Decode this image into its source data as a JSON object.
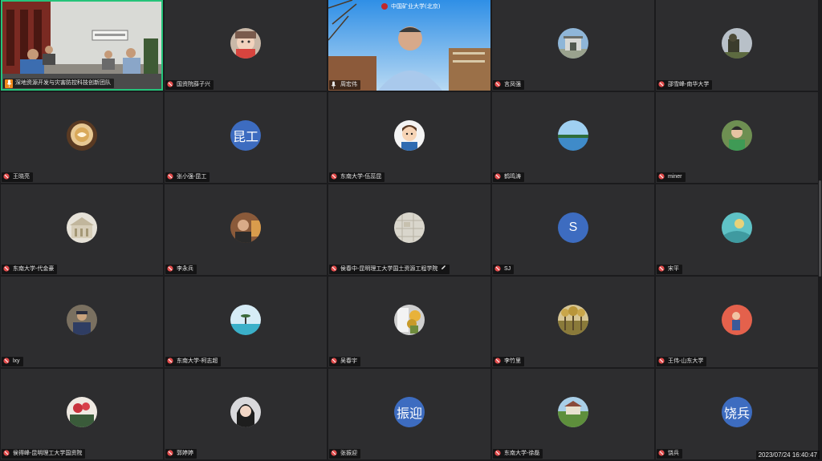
{
  "timestamp": "2023/07/24 16:40:47",
  "participants": [
    {
      "name": "深地资源开发与灾害防控科技创新团队",
      "avatar": "video-room",
      "mic": "active"
    },
    {
      "name": "国资院薛子兴",
      "avatar": "photo-baby"
    },
    {
      "name": "周宏伟",
      "avatar": "video-speaker",
      "mic": "on"
    },
    {
      "name": "言凤强",
      "avatar": "photo-gate"
    },
    {
      "name": "邵雪峰-南华大学",
      "avatar": "photo-dark"
    },
    {
      "name": "王晓亮",
      "avatar": "photo-coffee"
    },
    {
      "name": "张小强-昆工",
      "avatar": "text",
      "text": "昆工"
    },
    {
      "name": "东南大学-伍蕊昆",
      "avatar": "photo-cartoon"
    },
    {
      "name": "鹤鸣涛",
      "avatar": "photo-lake"
    },
    {
      "name": "miner",
      "avatar": "photo-person-green"
    },
    {
      "name": "东南大学-代金豪",
      "avatar": "photo-building"
    },
    {
      "name": "李永兵",
      "avatar": "photo-person-warm"
    },
    {
      "name": "侯春中-昆明理工大学国土资源工程学院",
      "avatar": "photo-map",
      "pencil": true
    },
    {
      "name": "SJ",
      "avatar": "text",
      "text": "S"
    },
    {
      "name": "宋平",
      "avatar": "photo-teal"
    },
    {
      "name": "lxy",
      "avatar": "photo-person-blue"
    },
    {
      "name": "东南大学-柯志超",
      "avatar": "photo-sea"
    },
    {
      "name": "吴春宇",
      "avatar": "photo-flowers"
    },
    {
      "name": "李竹里",
      "avatar": "photo-trees"
    },
    {
      "name": "王伟-山东大学",
      "avatar": "photo-red"
    },
    {
      "name": "侯得峰-昆明理工大学国资院",
      "avatar": "photo-rose"
    },
    {
      "name": "郭婷婷",
      "avatar": "photo-woman"
    },
    {
      "name": "张振迎",
      "avatar": "text",
      "text": "振迎"
    },
    {
      "name": "东南大学-徐磊",
      "avatar": "photo-garden"
    },
    {
      "name": "饶兵",
      "avatar": "text",
      "text": "饶兵"
    }
  ],
  "speaker_banner": "中国矿业大学(北京)",
  "room_sign": "深地资源开发与灾害防控"
}
